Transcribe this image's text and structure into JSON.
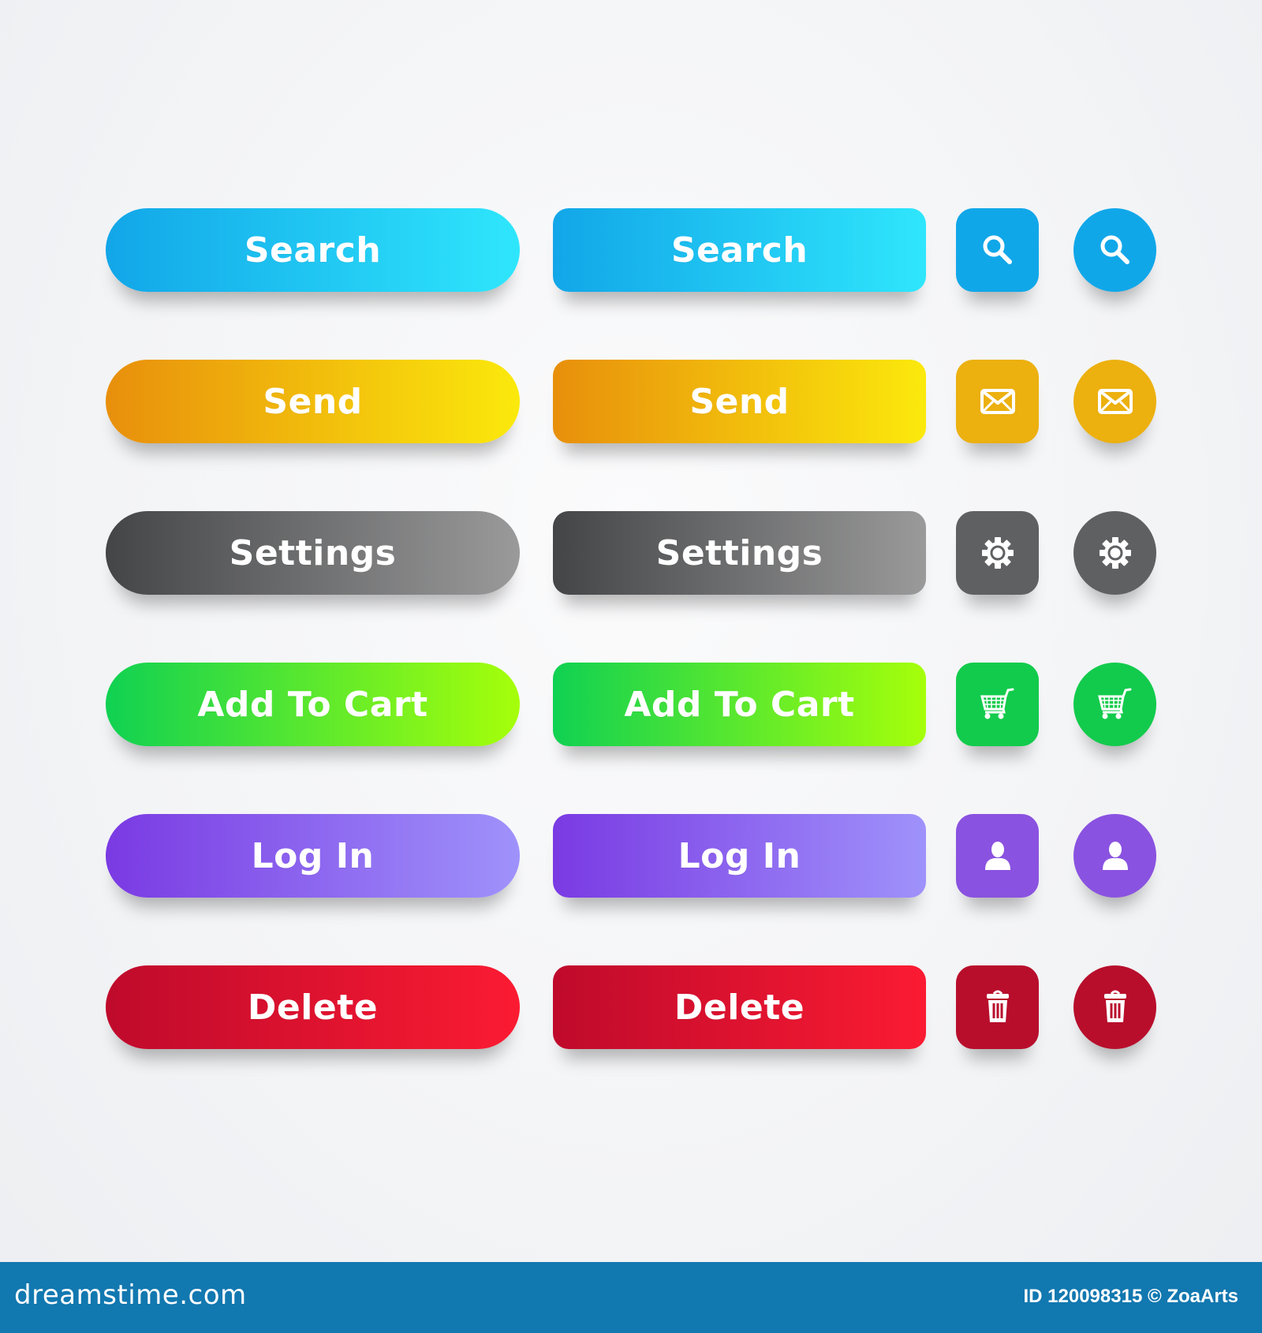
{
  "rows": [
    {
      "label": "Search",
      "icon": "search-icon",
      "gradient_from": "#12a6e8",
      "gradient_to": "#2fe6fc",
      "solid": "#10a7e9"
    },
    {
      "label": "Send",
      "icon": "mail-icon",
      "gradient_from": "#e88f0c",
      "gradient_to": "#fbe90c",
      "solid": "#ecb00f"
    },
    {
      "label": "Settings",
      "icon": "gear-icon",
      "gradient_from": "#444546",
      "gradient_to": "#9a9a9b",
      "solid": "#5f6062"
    },
    {
      "label": "Add To Cart",
      "icon": "cart-icon",
      "gradient_from": "#10d152",
      "gradient_to": "#a6ff0a",
      "solid": "#12cb4c"
    },
    {
      "label": "Log In",
      "icon": "user-icon",
      "gradient_from": "#7a3ae3",
      "gradient_to": "#9f92fb",
      "solid": "#8a52e0"
    },
    {
      "label": "Delete",
      "icon": "trash-icon",
      "gradient_from": "#bf0a2c",
      "gradient_to": "#fb1b32",
      "solid": "#b80e2c"
    }
  ],
  "footer": {
    "logo": "dreamstime.com",
    "credit": "ID 120098315 © ZoaArts"
  }
}
